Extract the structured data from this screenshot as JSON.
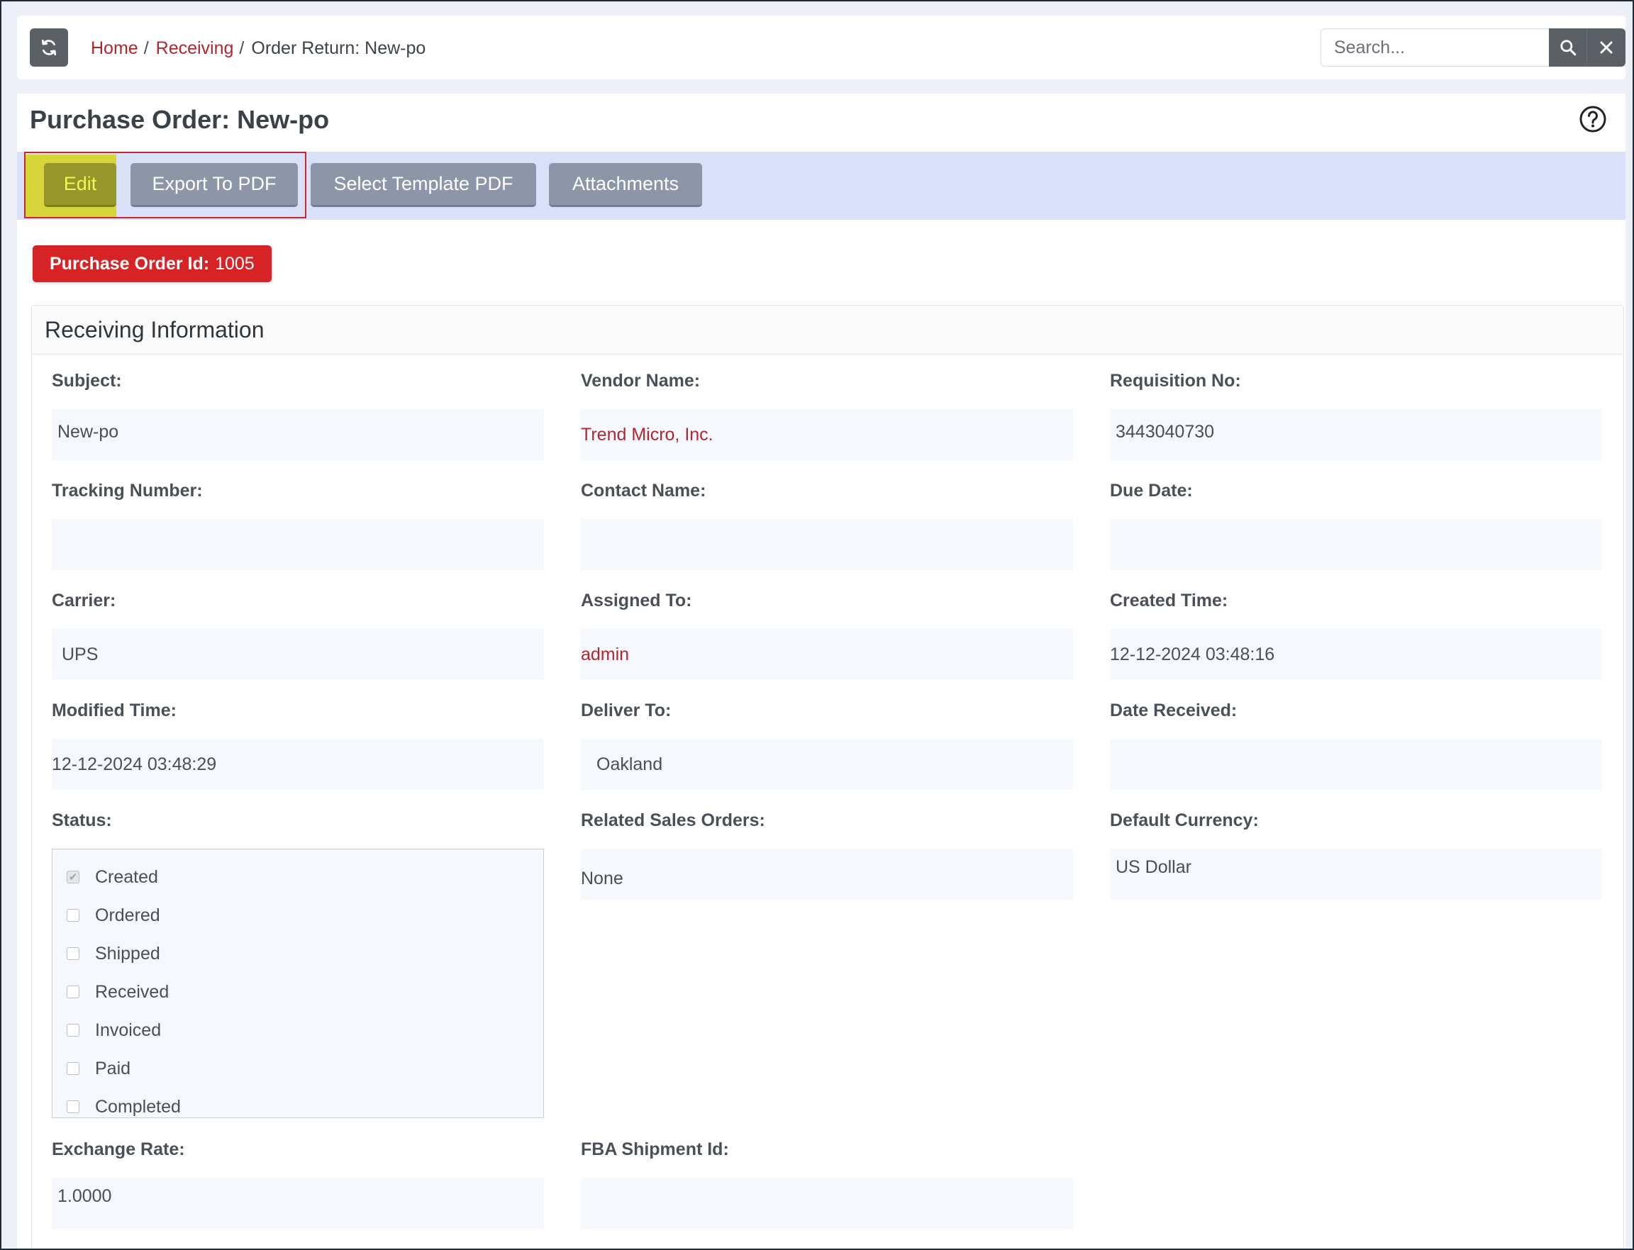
{
  "breadcrumb": {
    "home": "Home",
    "receiving": "Receiving",
    "current": "Order Return: New-po"
  },
  "search": {
    "placeholder": "Search...",
    "value": ""
  },
  "page": {
    "title": "Purchase Order: New-po"
  },
  "toolbar": {
    "edit_label": "Edit",
    "export_label": "Export To PDF",
    "template_label": "Select Template PDF",
    "attachments_label": "Attachments"
  },
  "badge": {
    "label": "Purchase Order Id:",
    "value": "1005"
  },
  "section": {
    "title": "Receiving Information"
  },
  "fields": {
    "subject": {
      "label": "Subject:",
      "value": "New-po"
    },
    "vendor_name": {
      "label": "Vendor Name:",
      "value": "Trend Micro, Inc."
    },
    "requisition_no": {
      "label": "Requisition No:",
      "value": "3443040730"
    },
    "tracking_number": {
      "label": "Tracking Number:",
      "value": ""
    },
    "contact_name": {
      "label": "Contact Name:",
      "value": ""
    },
    "due_date": {
      "label": "Due Date:",
      "value": ""
    },
    "carrier": {
      "label": "Carrier:",
      "value": "UPS"
    },
    "assigned_to": {
      "label": "Assigned To:",
      "value": "admin"
    },
    "created_time": {
      "label": "Created Time:",
      "value": "12-12-2024 03:48:16"
    },
    "modified_time": {
      "label": "Modified Time:",
      "value": "12-12-2024 03:48:29"
    },
    "deliver_to": {
      "label": "Deliver To:",
      "value": "Oakland"
    },
    "date_received": {
      "label": "Date Received:",
      "value": ""
    },
    "status": {
      "label": "Status:"
    },
    "related_sales_orders": {
      "label": "Related Sales Orders:",
      "value": "None"
    },
    "default_currency": {
      "label": "Default Currency:",
      "value": "US Dollar"
    },
    "exchange_rate": {
      "label": "Exchange Rate:",
      "value": "1.0000"
    },
    "fba_shipment_id": {
      "label": "FBA Shipment Id:",
      "value": ""
    }
  },
  "status_options": [
    {
      "label": "Created",
      "checked": true
    },
    {
      "label": "Ordered",
      "checked": false
    },
    {
      "label": "Shipped",
      "checked": false
    },
    {
      "label": "Received",
      "checked": false
    },
    {
      "label": "Invoiced",
      "checked": false
    },
    {
      "label": "Paid",
      "checked": false
    },
    {
      "label": "Completed",
      "checked": false
    }
  ],
  "colors": {
    "link": "#b3262d",
    "badge": "#d62326",
    "toolbar_bg": "#d9e0f7",
    "button": "#8d96a8",
    "edit_highlight": "#d6d63a"
  },
  "icons": {
    "refresh": "refresh-icon",
    "search": "search-icon",
    "clear": "close-icon",
    "help": "help-icon",
    "checkbox": "checkbox-icon"
  }
}
